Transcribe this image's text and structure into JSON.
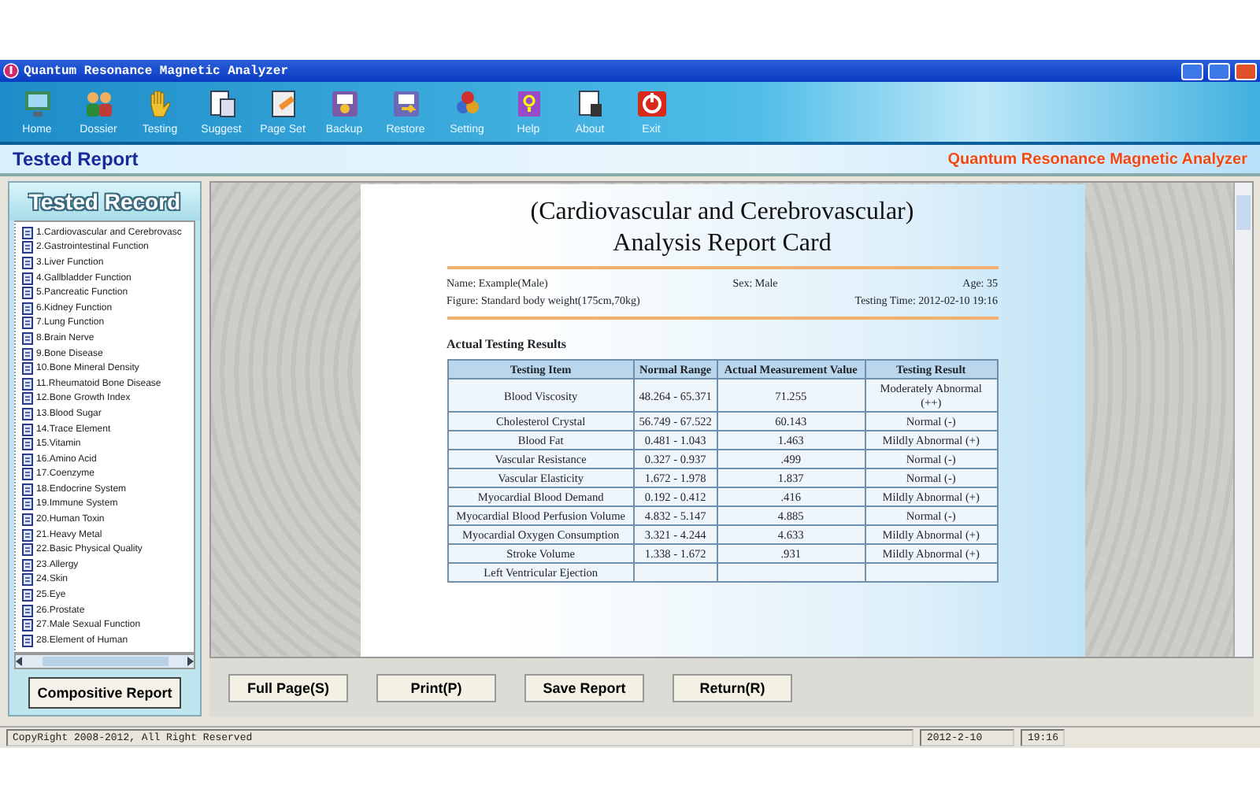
{
  "window": {
    "title": "Quantum Resonance Magnetic Analyzer"
  },
  "toolbar": [
    {
      "label": "Home"
    },
    {
      "label": "Dossier"
    },
    {
      "label": "Testing"
    },
    {
      "label": "Suggest"
    },
    {
      "label": "Page Set"
    },
    {
      "label": "Backup"
    },
    {
      "label": "Restore"
    },
    {
      "label": "Setting"
    },
    {
      "label": "Help"
    },
    {
      "label": "About"
    },
    {
      "label": "Exit"
    }
  ],
  "header": {
    "title": "Tested Report",
    "brand": "Quantum Resonance Magnetic Analyzer"
  },
  "sidebar": {
    "title": "Tested Record",
    "items": [
      "1.Cardiovascular and Cerebrovasc",
      "2.Gastrointestinal Function",
      "3.Liver Function",
      "4.Gallbladder Function",
      "5.Pancreatic Function",
      "6.Kidney Function",
      "7.Lung Function",
      "8.Brain Nerve",
      "9.Bone Disease",
      "10.Bone Mineral Density",
      "11.Rheumatoid Bone Disease",
      "12.Bone Growth Index",
      "13.Blood Sugar",
      "14.Trace Element",
      "15.Vitamin",
      "16.Amino Acid",
      "17.Coenzyme",
      "18.Endocrine System",
      "19.Immune System",
      "20.Human Toxin",
      "21.Heavy Metal",
      "22.Basic Physical Quality",
      "23.Allergy",
      "24.Skin",
      "25.Eye",
      "26.Prostate",
      "27.Male Sexual Function",
      "28.Element of Human"
    ],
    "button": "Compositive Report"
  },
  "report": {
    "title": [
      "(Cardiovascular and Cerebrovascular)",
      "Analysis Report Card"
    ],
    "info": [
      [
        "Name: Example(Male)",
        "Sex: Male",
        "Age: 35"
      ],
      [
        "Figure: Standard body weight(175cm,70kg)",
        "Testing Time: 2012-02-10 19:16"
      ]
    ],
    "section": "Actual Testing Results",
    "table": {
      "columns": [
        "Testing Item",
        "Normal Range",
        "Actual Measurement Value",
        "Testing Result"
      ],
      "rows": [
        [
          "Blood Viscosity",
          "48.264 - 65.371",
          "71.255",
          "Moderately Abnormal (++)"
        ],
        [
          "Cholesterol Crystal",
          "56.749 - 67.522",
          "60.143",
          "Normal (-)"
        ],
        [
          "Blood Fat",
          "0.481 - 1.043",
          "1.463",
          "Mildly Abnormal (+)"
        ],
        [
          "Vascular Resistance",
          "0.327 - 0.937",
          ".499",
          "Normal (-)"
        ],
        [
          "Vascular Elasticity",
          "1.672 - 1.978",
          "1.837",
          "Normal (-)"
        ],
        [
          "Myocardial Blood Demand",
          "0.192 - 0.412",
          ".416",
          "Mildly Abnormal (+)"
        ],
        [
          "Myocardial Blood Perfusion Volume",
          "4.832 - 5.147",
          "4.885",
          "Normal (-)"
        ],
        [
          "Myocardial Oxygen Consumption",
          "3.321 - 4.244",
          "4.633",
          "Mildly Abnormal (+)"
        ],
        [
          "Stroke Volume",
          "1.338 - 1.672",
          ".931",
          "Mildly Abnormal (+)"
        ],
        [
          "Left Ventricular Ejection",
          "",
          "",
          ""
        ]
      ]
    }
  },
  "buttons": [
    "Full Page(S)",
    "Print(P)",
    "Save Report",
    "Return(R)"
  ],
  "status_bar": {
    "copyright": "CopyRight 2008-2012, All Right Reserved",
    "date": "2012-2-10",
    "time": "19:16"
  }
}
